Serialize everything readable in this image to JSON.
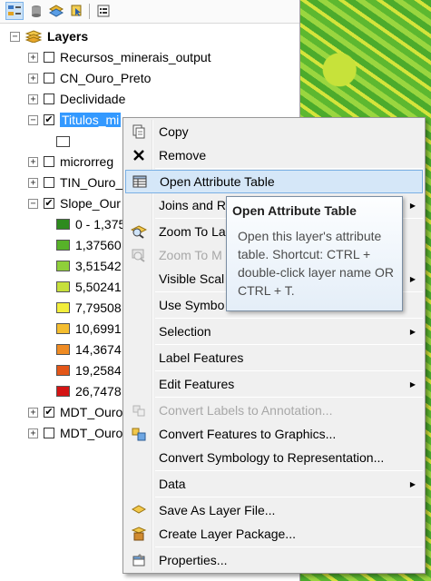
{
  "toc": {
    "root_label": "Layers",
    "layers": [
      {
        "label": "Recursos_minerais_output",
        "checked": false
      },
      {
        "label": "CN_Ouro_Preto",
        "checked": false
      },
      {
        "label": "Declividade",
        "checked": false
      },
      {
        "label": "Titulos_mi",
        "checked": true
      },
      {
        "label": "microrreg",
        "checked": false
      },
      {
        "label": "TIN_Ouro_",
        "checked": false
      },
      {
        "label": "Slope_Our",
        "checked": true
      },
      {
        "label": "MDT_Ouro",
        "checked": true
      },
      {
        "label": "MDT_Ouro",
        "checked": false
      }
    ],
    "slope_classes": [
      {
        "label": "0 - 1,375",
        "color": "#2e8b1e"
      },
      {
        "label": "1,37560",
        "color": "#57b229"
      },
      {
        "label": "3,51542",
        "color": "#8fcf3a"
      },
      {
        "label": "5,50241",
        "color": "#c6e03b"
      },
      {
        "label": "7,79508",
        "color": "#f2ee3c"
      },
      {
        "label": "10,6991",
        "color": "#f4bd2f"
      },
      {
        "label": "14,3674",
        "color": "#ef8b23"
      },
      {
        "label": "19,2584",
        "color": "#e35618"
      },
      {
        "label": "26,7478",
        "color": "#d41414"
      }
    ]
  },
  "context_menu": {
    "items": {
      "copy": "Copy",
      "remove": "Remove",
      "open_attribute_table": "Open Attribute Table",
      "joins_and_relates": "Joins and R",
      "zoom_to_layer": "Zoom To La",
      "zoom_to_make_visible": "Zoom To M",
      "visible_scale_range": "Visible Scal",
      "use_symbol_levels": "Use Symbo",
      "selection": "Selection",
      "label_features": "Label Features",
      "edit_features": "Edit Features",
      "convert_labels": "Convert Labels to Annotation...",
      "convert_features": "Convert Features to Graphics...",
      "convert_symbology": "Convert Symbology to Representation...",
      "data": "Data",
      "save_as_layer_file": "Save As Layer File...",
      "create_layer_package": "Create Layer Package...",
      "properties": "Properties..."
    }
  },
  "tooltip": {
    "title": "Open Attribute Table",
    "body": "Open this layer's attribute table. Shortcut: CTRL + double-click layer name OR CTRL + T."
  },
  "colors": {
    "selection": "#3399ff",
    "menu_highlight": "#d5e7f8",
    "menu_background": "#f0f0f0"
  }
}
